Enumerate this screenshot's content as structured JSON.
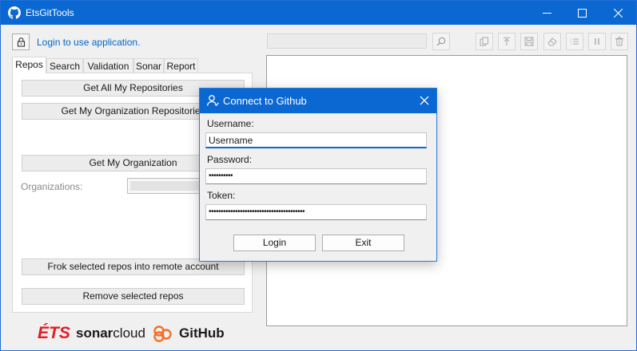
{
  "window": {
    "title": "EtsGitTools",
    "controls": {
      "minimize": "minimize-icon",
      "maximize": "maximize-icon",
      "close": "close-icon"
    }
  },
  "header": {
    "login_link": "Login to use application.",
    "lock_icon": "lock-icon"
  },
  "tabs": [
    "Repos",
    "Search",
    "Validation",
    "Sonar",
    "Report"
  ],
  "repos": {
    "get_all_repos": "Get All My Repositories",
    "get_org_repos": "Get My Organization Repositories",
    "get_org": "Get My Organization",
    "organizations_label": "Organizations:",
    "fork_repos": "Frok selected repos into remote account",
    "remove_repos": "Remove selected repos"
  },
  "logos": {
    "ets": "ÉTS",
    "sonarcloud": "sonarcloud",
    "github": "GitHub"
  },
  "toolbar": {
    "search_placeholder": "",
    "icons": [
      "search-icon",
      "copy-icon",
      "upload-icon",
      "save-icon",
      "eraser-icon",
      "list-icon",
      "pause-icon",
      "trash-icon"
    ]
  },
  "dialog": {
    "title": "Connect to Github",
    "username_label": "Username:",
    "username_value": "Username",
    "password_label": "Password:",
    "password_value": "••••••••••",
    "token_label": "Token:",
    "token_value": "••••••••••••••••••••••••••••••••••••••••",
    "login_button": "Login",
    "exit_button": "Exit"
  },
  "colors": {
    "titlebar": "#0b67d1",
    "link": "#0066cc",
    "ets_red": "#e31b23",
    "sonar_orange": "#f3702a"
  }
}
